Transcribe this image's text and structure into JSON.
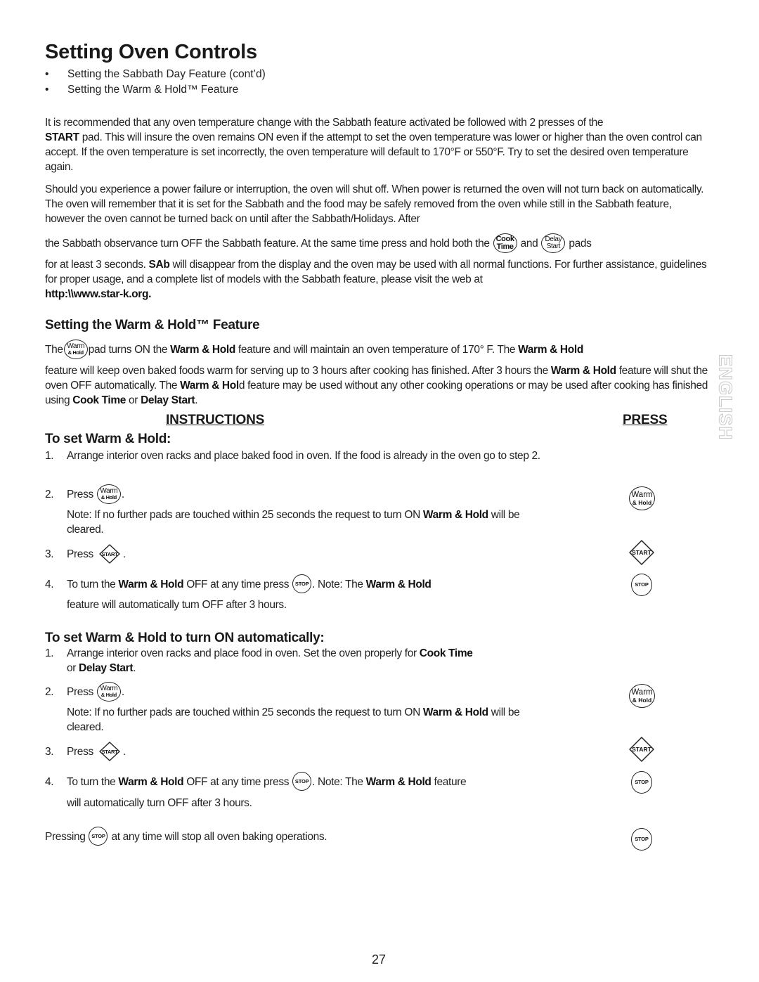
{
  "header": {
    "title": "Setting Oven Controls",
    "bullets": [
      "Setting the Sabbath Day Feature (cont’d)",
      "Setting the Warm & Hold™ Feature"
    ]
  },
  "sabbath": {
    "p1": {
      "a": "It is recommended that any oven temperature change with the Sabbath feature activated be followed with 2 presses of the",
      "b_bold": "START",
      "b": " pad. This will insure the oven remains ON even if the attempt to set the oven temperature was lower or higher than the oven control can accept. If the oven temperature is set incorrectly, the oven temperature will default to 170°F or 550°F. Try to set the desired oven temperature again."
    },
    "p2": {
      "a": "Should you experience a power failure or interruption, the oven will shut off. When power is returned the oven will not turn back on automatically. The oven will remember that it is set for the Sabbath and the food may be safely removed from the oven while still in the Sabbath feature, however the oven cannot be turned back on until after the Sabbath/Holidays. After",
      "b": "the Sabbath observance turn OFF the Sabbath feature. At the same time press and hold both the",
      "and": "and",
      "pads": "pads",
      "c_pre": "for at least 3 seconds. ",
      "c_bold": "SAb",
      "c": " will disappear from the display and the oven may be used with all normal functions. For further assistance, guidelines for proper usage, and a complete list of models with the Sabbath feature, please visit the web at",
      "url": "http:\\\\www.star-k.org."
    }
  },
  "pads": {
    "cook_time": [
      "Cook",
      "Time"
    ],
    "delay_start": [
      "Delay",
      "Start"
    ],
    "warm_hold": [
      "Warm",
      "& Hold"
    ],
    "start": "START",
    "stop": "STOP"
  },
  "warm_hold": {
    "heading": "Setting the Warm & Hold™ Feature",
    "intro": {
      "the": "The",
      "s1": "pad turns ON the ",
      "b1": "Warm & Hold",
      "s2": " feature and will maintain an oven temperature of 170° F. The ",
      "b2": "Warm & Hold",
      "s3": "feature will keep oven baked foods warm for serving up to 3 hours after cooking has finished. After 3 hours the ",
      "b3": "Warm & Hold",
      "s4": " feature will shut the oven OFF automatically. The ",
      "b4": "Warm & Hol",
      "s5": "d feature may be used without any other cooking operations or may be used after cooking has finished using ",
      "b5": "Cook Time",
      "s6": " or ",
      "b6": "Delay Start",
      "s7": "."
    }
  },
  "columns": {
    "instructions": "INSTRUCTIONS",
    "press": "PRESS"
  },
  "section1": {
    "heading": "To set Warm & Hold:",
    "steps": [
      {
        "num": "1.",
        "text": "Arrange interior oven racks and place baked food in oven. If the food is already in the oven go to step 2."
      },
      {
        "num": "2.",
        "press": "Press",
        "note_a": "Note: If no further pads are touched within 25 seconds the request to turn ON ",
        "note_b": "Warm & Hold",
        "note_c": " will be cleared."
      },
      {
        "num": "3.",
        "press": "Press"
      },
      {
        "num": "4.",
        "a": "To turn the ",
        "b": "Warm & Hold",
        "c": " OFF at any time press ",
        "d": ". Note: The ",
        "e": "Warm & Hold",
        "f": "feature will automatically tum OFF after 3 hours."
      }
    ]
  },
  "section2": {
    "heading": "To set Warm & Hold to turn ON automatically:",
    "steps": [
      {
        "num": "1.",
        "a": "Arrange interior oven racks and place food in oven. Set the oven properly for ",
        "b": "Cook Time",
        "c": "or ",
        "d": "Delay Start",
        "e": "."
      },
      {
        "num": "2.",
        "press": "Press",
        "note_a": "Note: If no further pads are touched within 25 seconds the request to turn ON ",
        "note_b": "Warm & Hold",
        "note_c": " will be cleared."
      },
      {
        "num": "3.",
        "press": "Press"
      },
      {
        "num": "4.",
        "a": "To turn the ",
        "b": "Warm & Hold",
        "c": " OFF at any time press ",
        "d": ". Note: The ",
        "e": "Warm & Hold",
        "e2": " feature",
        "f": "will automatically turn OFF after 3 hours."
      }
    ]
  },
  "footer": {
    "pressing": "Pressing",
    "stop_note": " at any time will stop all oven baking operations.",
    "page_number": "27"
  },
  "side_tab": {
    "label": "ENGLISH"
  }
}
